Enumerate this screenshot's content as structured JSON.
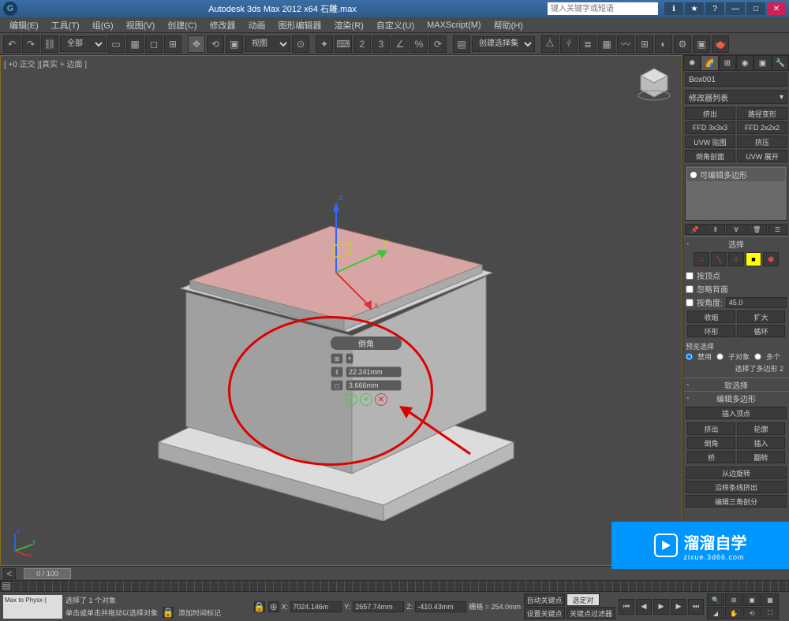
{
  "titlebar": {
    "title": "Autodesk 3ds Max  2012 x64   石雕.max",
    "search_placeholder": "键入关键字或短语"
  },
  "menubar": {
    "items": [
      "编辑(E)",
      "工具(T)",
      "组(G)",
      "视图(V)",
      "创建(C)",
      "修改器",
      "动画",
      "图形编辑器",
      "渲染(R)",
      "自定义(U)",
      "MAXScript(M)",
      "帮助(H)"
    ]
  },
  "toolbar": {
    "all_label": "全部",
    "view_label": "视图",
    "selection_set": "创建选择集"
  },
  "viewport": {
    "label": "[ +0 正交 ][真实 + 边面 ]"
  },
  "caddy": {
    "title": "倒角",
    "value1": "22.241mm",
    "value2": "3.666mm"
  },
  "right_panel": {
    "object_name": "Box001",
    "modifier_list": "修改器列表",
    "preset_buttons": [
      "挤出",
      "路径变形",
      "FFD 3x3x3",
      "FFD 2x2x2",
      "UVW 贴图",
      "挤压",
      "倒角剖面",
      "UVW 展开"
    ],
    "stack_item": "可编辑多边形",
    "sections": {
      "selection": {
        "title": "选择",
        "by_vertex": "按顶点",
        "ignore_backface": "忽略背面",
        "by_angle": "按角度:",
        "angle_value": "45.0",
        "shrink": "收缩",
        "grow": "扩大",
        "ring": "环形",
        "loop": "循环",
        "preview_label": "预览选择",
        "preview_disable": "禁用",
        "preview_subobj": "子对象",
        "preview_multi": "多个",
        "status": "选择了多边形 2"
      },
      "soft_selection": "软选择",
      "edit_poly": {
        "title": "编辑多边形",
        "insert_vertex": "插入顶点",
        "extrude": "挤出",
        "outline": "轮廓",
        "bevel": "倒角",
        "inset": "插入",
        "bridge": "桥",
        "flip": "翻转",
        "hinge": "从边旋转",
        "extrude_spline": "沿样条线挤出",
        "edit_tri": "编辑三角剖分"
      }
    }
  },
  "timeslider": {
    "frame": "0 / 100"
  },
  "statusbar": {
    "script": "Max to Physx (",
    "selected": "选择了 1 个对象",
    "prompt": "单击或单击并拖动以选择对象",
    "add_timetag": "添加时间标记",
    "x": "7024.146m",
    "y": "2657.74mm",
    "z": "-410.43mm",
    "grid": "栅格 = 254.0mm",
    "autokey": "自动关键点",
    "selected_tgt": "选定对",
    "setkey": "设置关键点",
    "keyfilter": "关键点过滤器"
  },
  "watermark": {
    "big": "溜溜自学",
    "small": "zixue.3d66.com"
  }
}
